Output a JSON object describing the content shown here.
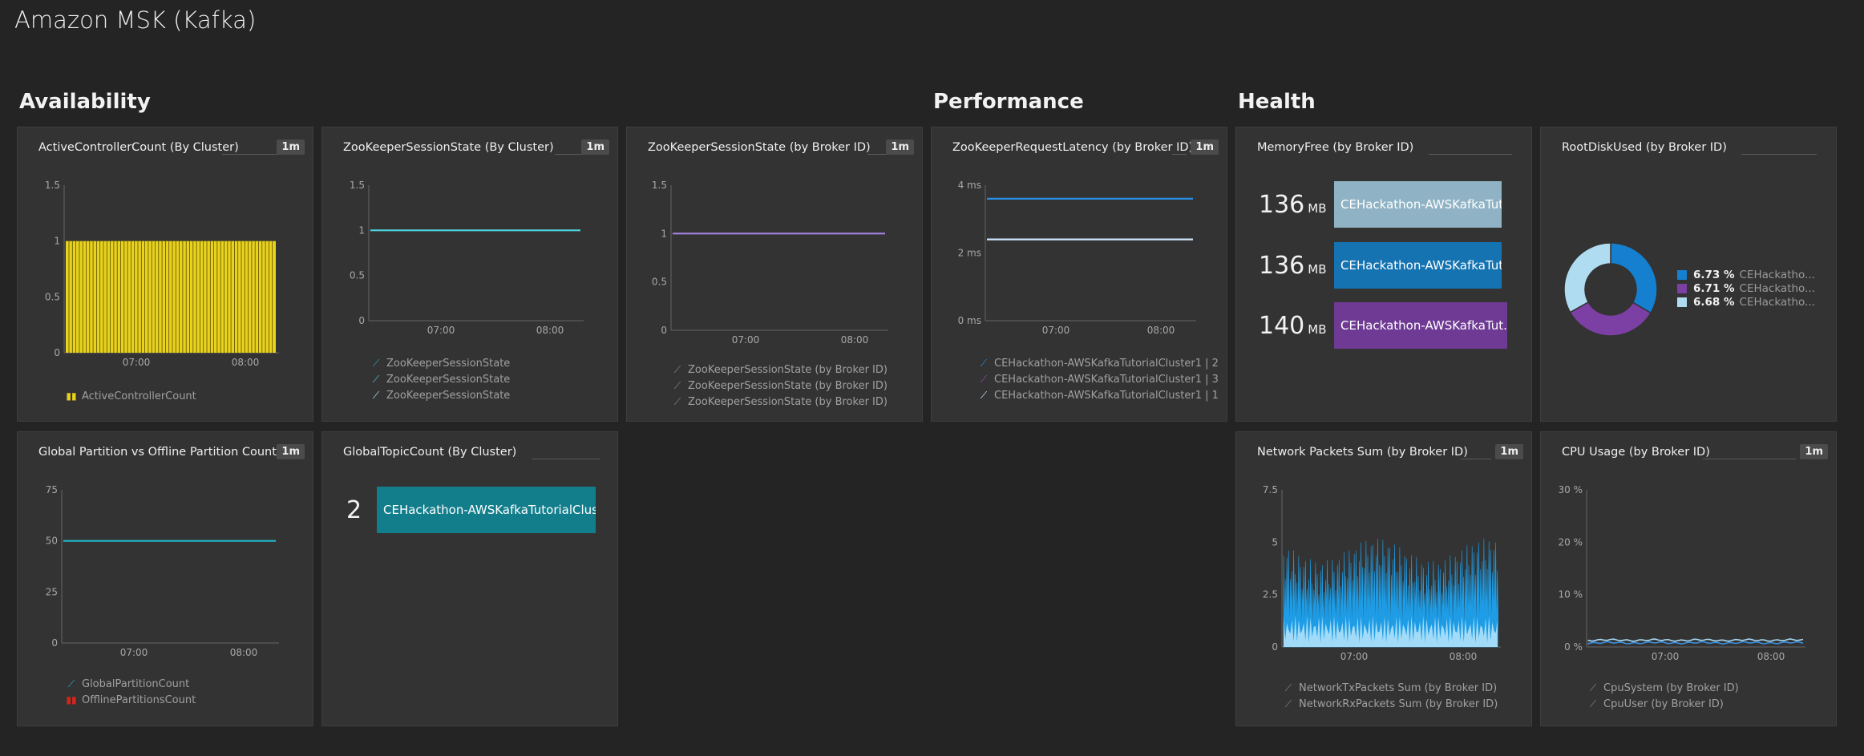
{
  "page": {
    "title": "Amazon MSK (Kafka)"
  },
  "sections": {
    "availability": "Availability",
    "performance": "Performance",
    "health": "Health"
  },
  "tiles": {
    "active_controller": {
      "title": "ActiveControllerCount (By Cluster)",
      "badge": "1m",
      "legend": [
        {
          "label": "ActiveControllerCount",
          "icon": "bar-chart-icon",
          "color": "#e8d21d"
        }
      ],
      "chart_data": {
        "type": "bar",
        "yticks": [
          "1.5",
          "1",
          "0.5",
          "0"
        ],
        "xticks": [
          "07:00",
          "08:00"
        ],
        "ylim": [
          0,
          1.5
        ],
        "series": [
          {
            "name": "ActiveControllerCount",
            "color": "#e8d21d",
            "value": 1
          }
        ]
      }
    },
    "zk_state_cluster": {
      "title": "ZooKeeperSessionState (By Cluster)",
      "badge": "1m",
      "legend": [
        {
          "label": "ZooKeeperSessionState",
          "icon": "line-chart-icon",
          "color": "#26a8c6"
        },
        {
          "label": "ZooKeeperSessionState",
          "icon": "line-chart-icon",
          "color": "#4fd5e0"
        },
        {
          "label": "ZooKeeperSessionState",
          "icon": "line-chart-icon",
          "color": "#b3f0f5"
        }
      ],
      "chart_data": {
        "type": "line",
        "yticks": [
          "1.5",
          "1",
          "0.5",
          "0"
        ],
        "xticks": [
          "07:00",
          "08:00"
        ],
        "ylim": [
          0,
          1.5
        ],
        "series": [
          {
            "name": "ZooKeeperSessionState",
            "color": "#4fd5e0",
            "value": 1
          }
        ]
      }
    },
    "zk_state_broker": {
      "title": "ZooKeeperSessionState (by Broker ID)",
      "badge": "1m",
      "legend": [
        {
          "label": "ZooKeeperSessionState (by Broker ID)",
          "icon": "line-chart-icon",
          "color": "#8a8a8a"
        },
        {
          "label": "ZooKeeperSessionState (by Broker ID)",
          "icon": "line-chart-icon",
          "color": "#8a8a8a"
        },
        {
          "label": "ZooKeeperSessionState (by Broker ID)",
          "icon": "line-chart-icon",
          "color": "#8a8a8a"
        }
      ],
      "chart_data": {
        "type": "line",
        "yticks": [
          "1.5",
          "1",
          "0.5",
          "0"
        ],
        "xticks": [
          "07:00",
          "08:00"
        ],
        "ylim": [
          0,
          1.5
        ],
        "series": [
          {
            "name": "ZooKeeperSessionState (by Broker ID)",
            "color": "#a184e0",
            "value": 1
          }
        ]
      }
    },
    "zk_latency": {
      "title": "ZooKeeperRequestLatency (by Broker ID)",
      "badge": "1m",
      "legend": [
        {
          "label": "CEHackathon-AWSKafkaTutorialCluster1 | 2",
          "icon": "line-chart-icon",
          "color": "#2a8fe8"
        },
        {
          "label": "CEHackathon-AWSKafkaTutorialCluster1 | 3",
          "icon": "line-chart-icon",
          "color": "#9b4fc9"
        },
        {
          "label": "CEHackathon-AWSKafkaTutorialCluster1 | 1",
          "icon": "line-chart-icon",
          "color": "#cfe6ff"
        }
      ],
      "chart_data": {
        "type": "line",
        "yticks": [
          "4 ms",
          "2 ms",
          "0 ms"
        ],
        "xticks": [
          "07:00",
          "08:00"
        ],
        "ylim": [
          0,
          4
        ],
        "series": [
          {
            "name": "CEHackathon-AWSKafkaTutorialCluster1 | 2",
            "color": "#2a8fe8",
            "value": 3.6
          },
          {
            "name": "CEHackathon-AWSKafkaTutorialCluster1 | 1",
            "color": "#cfe6ff",
            "value": 2.4
          }
        ]
      }
    },
    "memory_free": {
      "title": "MemoryFree (by Broker ID)",
      "rows": [
        {
          "value": "136",
          "unit": "MB",
          "label": "CEHackathon-AWSKafkaTut...",
          "color": "#8fb3c4"
        },
        {
          "value": "136",
          "unit": "MB",
          "label": "CEHackathon-AWSKafkaTut...",
          "color": "#1473b0"
        },
        {
          "value": "140",
          "unit": "MB",
          "label": "CEHackathon-AWSKafkaTut...",
          "color": "#6e3a93"
        }
      ]
    },
    "root_disk": {
      "title": "RootDiskUsed (by Broker ID)",
      "chart_data": {
        "type": "pie",
        "donut": true,
        "slices": [
          {
            "pct": "6.73 %",
            "value": 6.73,
            "label": "CEHackatho...",
            "color": "#1580d0"
          },
          {
            "pct": "6.71 %",
            "value": 6.71,
            "label": "CEHackatho...",
            "color": "#7c3fa3"
          },
          {
            "pct": "6.68 %",
            "value": 6.68,
            "label": "CEHackatho...",
            "color": "#b0dcf2"
          }
        ]
      }
    },
    "partition": {
      "title": "Global Partition vs Offline Partition Count (By",
      "badge": "1m",
      "legend": [
        {
          "label": "GlobalPartitionCount",
          "icon": "line-chart-icon",
          "color": "#1fb6c8"
        },
        {
          "label": "OfflinePartitionsCount",
          "icon": "bar-chart-icon",
          "color": "#d7241c"
        }
      ],
      "chart_data": {
        "type": "line",
        "yticks": [
          "75",
          "50",
          "25",
          "0"
        ],
        "xticks": [
          "07:00",
          "08:00"
        ],
        "ylim": [
          0,
          75
        ],
        "series": [
          {
            "name": "GlobalPartitionCount",
            "color": "#1fb6c8",
            "value": 50
          }
        ]
      }
    },
    "topic_count": {
      "title": "GlobalTopicCount (By Cluster)",
      "value": "2",
      "label": "CEHackathon-AWSKafkaTutorialClus...",
      "color": "#127e8c"
    },
    "network": {
      "title": "Network Packets Sum (by Broker ID)",
      "badge": "1m",
      "legend": [
        {
          "label": "NetworkTxPackets Sum (by Broker ID)",
          "icon": "line-chart-icon",
          "color": "#8a8a8a"
        },
        {
          "label": "NetworkRxPackets Sum (by Broker ID)",
          "icon": "line-chart-icon",
          "color": "#8a8a8a"
        }
      ],
      "chart_data": {
        "type": "area",
        "yticks": [
          "7.5",
          "5",
          "2.5",
          "0"
        ],
        "xticks": [
          "07:00",
          "08:00"
        ],
        "ylim": [
          0,
          7.5
        ],
        "series": [
          {
            "name": "NetworkTxPackets Sum (by Broker ID)",
            "color": "#1e9de6",
            "range": [
              2.5,
              5.2
            ]
          },
          {
            "name": "NetworkRxPackets Sum (by Broker ID)",
            "color": "#b8e6fa",
            "range": [
              0.2,
              1.5
            ]
          }
        ]
      }
    },
    "cpu": {
      "title": "CPU Usage (by Broker ID)",
      "badge": "1m",
      "legend": [
        {
          "label": "CpuSystem (by Broker ID)",
          "icon": "line-chart-icon",
          "color": "#8a8a8a"
        },
        {
          "label": "CpuUser (by Broker ID)",
          "icon": "line-chart-icon",
          "color": "#8a8a8a"
        }
      ],
      "chart_data": {
        "type": "line",
        "yticks": [
          "30 %",
          "20 %",
          "10 %",
          "0 %"
        ],
        "xticks": [
          "07:00",
          "08:00"
        ],
        "ylim": [
          0,
          30
        ],
        "series": [
          {
            "name": "CpuSystem (by Broker ID)",
            "color": "#3b8fe0",
            "value": 0.8
          },
          {
            "name": "CpuUser (by Broker ID)",
            "color": "#a9dcf5",
            "value": 1.3
          }
        ]
      }
    }
  }
}
